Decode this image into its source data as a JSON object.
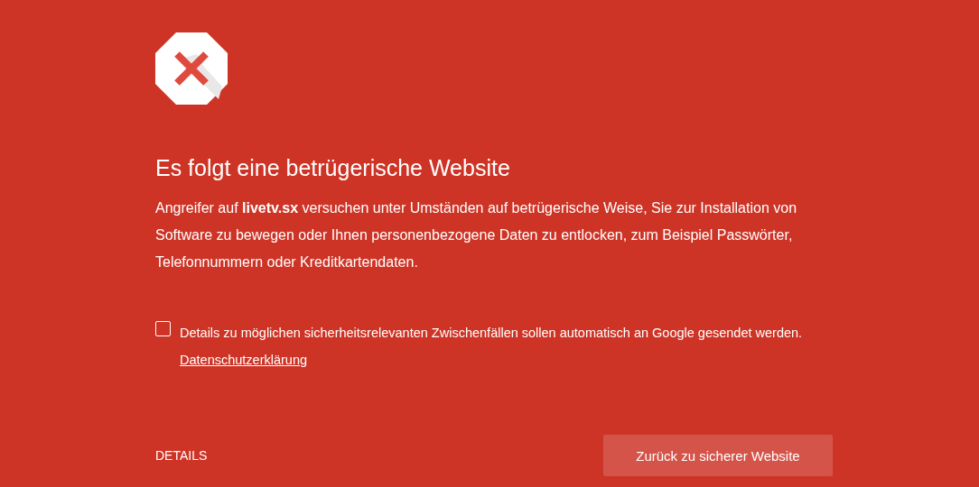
{
  "heading": "Es folgt eine betrügerische Website",
  "message": "Angreifer auf **livetv.sx** versuchen unter Umständen auf betrügerische Weise, Sie zur Installation von Software zu bewegen oder Ihnen personenbezogene Daten zu entlocken, zum Beispiel Passwörter, Telefonnummern oder Kreditkartendaten.",
  "report": {
    "checked": false,
    "text": "Details zu möglichen sicherheitsrelevanten Zwischenfällen sollen automatisch an Google gesendet werden.",
    "link": "Datenschutzerklärung"
  },
  "details_link": "DETAILS",
  "back_button": "Zurück zu sicherer Website"
}
